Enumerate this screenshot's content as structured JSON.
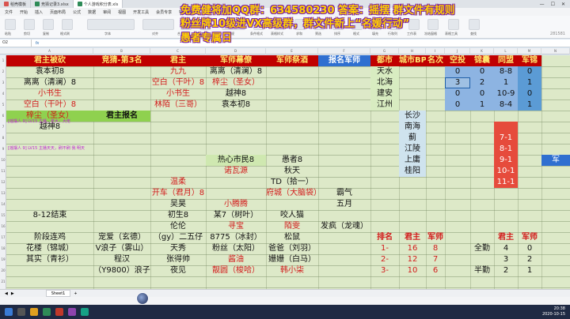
{
  "tabs": [
    {
      "label": "稻壳模板",
      "color": "#d9534f"
    },
    {
      "label": "竞猜记录3.xlsx",
      "color": "#2e8b57"
    },
    {
      "label": "个人游戏积分表.xls",
      "color": "#2e8b57"
    }
  ],
  "menu": [
    "文件",
    "开始",
    "插入",
    "页面布局",
    "公式",
    "数据",
    "审阅",
    "视图",
    "开发工具",
    "会员专享",
    "特色应用"
  ],
  "ribbon_labels": [
    "粘贴",
    "剪切",
    "复制",
    "格式刷",
    "字体",
    "对齐",
    "合并居中",
    "自动换行",
    "常规",
    "条件格式",
    "表格样式",
    "求和",
    "筛选",
    "排序",
    "格式",
    "填充",
    "行和列",
    "工作表",
    "冻结窗格",
    "表格工具",
    "查找"
  ],
  "sheet_id": "281581",
  "namebox": "O2",
  "ad": {
    "line1": "免费健将加QQ群：634580230 答案：摇摆 群文件有规则",
    "line2": "粉丝牌10级进VX高级群，群文件新上“名媛行动”",
    "line3": "愚者专属日"
  },
  "col_letters": [
    "A",
    "B",
    "C",
    "D",
    "E",
    "F",
    "G",
    "H",
    "I",
    "J",
    "K",
    "L",
    "M",
    "N",
    "O",
    "P",
    "Q",
    "R"
  ],
  "row_numbers": [
    "1",
    "2",
    "3",
    "4",
    "5",
    "6",
    "7",
    "8",
    "9",
    "10",
    "11",
    "12",
    "13",
    "14",
    "15",
    "16",
    "17",
    "18",
    "19",
    "20",
    "21"
  ],
  "headers": {
    "c1": "君主被砍",
    "c2": "竞猜-第3名",
    "c3": "君主",
    "c4": "军师幕僚",
    "c5": "军师祭酒",
    "c6": "报名军师",
    "c7": "都市",
    "c8": "城市BP",
    "c9": "名次",
    "c10": "空投",
    "c11": "锦囊",
    "c12": "同盟",
    "c13": "军锦"
  },
  "rows": {
    "r2": {
      "a": "袁本初8",
      "c": "九九",
      "d": "离离（清澜）8",
      "g": "天水",
      "j": "0",
      "k": "0",
      "l": "8-8",
      "m": "0"
    },
    "r3": {
      "a": "离离（清澜）8",
      "c": "空白（干叶）8",
      "d": "梓尘（圣女）",
      "g": "北海",
      "j": "3",
      "k": "2",
      "l": "1",
      "m": "1"
    },
    "r4": {
      "a": "小书生",
      "c": "小书生",
      "d": "越神8",
      "g": "建安",
      "j": "0",
      "k": "0",
      "l": "10-9",
      "m": "0"
    },
    "r5": {
      "a": "空白（干叶）8",
      "c": "林陌（三哥）",
      "d": "袁本初8",
      "g": "江州",
      "j": "0",
      "k": "1",
      "l": "8-4",
      "m": "1"
    },
    "r6": {
      "a": "梓尘（圣女）",
      "b": "君主报名",
      "h": "长沙"
    },
    "r7": {
      "a": "越神8",
      "h": "南海"
    },
    "r8": {
      "h": "蓟",
      "l": "7-1"
    },
    "r9": {
      "h": "江陵",
      "l": "8-1"
    },
    "r10": {
      "d": "热心市民8",
      "e": "愚者8",
      "h": "上庸",
      "l": "9-1",
      "n": "军"
    },
    "r11": {
      "d": "诺瓦源",
      "e": "秋天",
      "h": "桂阳",
      "l": "10-1"
    },
    "r12": {
      "c": "温柔",
      "e": "TD（拾一）",
      "l": "11-1"
    },
    "r13": {
      "c": "开车（君月）8",
      "e": "府城（大脑袋）",
      "f": "霸气"
    },
    "r14": {
      "c": "吴昊",
      "d": "小腾腾",
      "f": "五月"
    },
    "r15": {
      "a": "8-12结束",
      "c": "初生8",
      "d": "某7（树叶）",
      "e": "咬人猫"
    },
    "r16": {
      "c": "伦伦",
      "d": "寻宝",
      "e": "陌雯",
      "f": "发疯（龙魂）"
    },
    "r17": {
      "a": "阶段连鸡",
      "b": "宠爱（玄德）",
      "c": "（gy）二五仔",
      "d": "8775（冰封）",
      "e": "松鼠",
      "g": "排名",
      "h": "君主",
      "i": "军师",
      "l": "君主",
      "m": "军师"
    },
    "r18": {
      "a": "花楼（锦城）",
      "b": "V浪子（雾山）",
      "c": "天秀",
      "d": "粉丝（太阳）",
      "e": "爸爸（刘羽）",
      "g": "1-",
      "h": "16",
      "i": "8",
      "k": "全勤",
      "l": "4",
      "m": "0"
    },
    "r19": {
      "a": "其实（青衫）",
      "b": "程汉",
      "c": "张得帅",
      "d": "酱油",
      "e": "姗姗（白马）",
      "g": "2-",
      "h": "12",
      "i": "7",
      "l": "3",
      "m": "2"
    },
    "r20": {
      "b": "（Y9800）浪子",
      "c": "夜见",
      "d": "靓圆（梭哈）",
      "e": "韩小柒",
      "g": "3-",
      "h": "10",
      "i": "6",
      "k": "半勤",
      "l": "2",
      "m": "1"
    }
  },
  "chat": [
    "[摇摆人 9] LV15  主播，老大，大佬",
    "[摇摆人 9] LV15  主播天天，刷不刷 我  明天"
  ],
  "sheet_tab": "Sheet1",
  "status": "",
  "clock": {
    "time": "20:38",
    "date": "2020-10-15"
  }
}
